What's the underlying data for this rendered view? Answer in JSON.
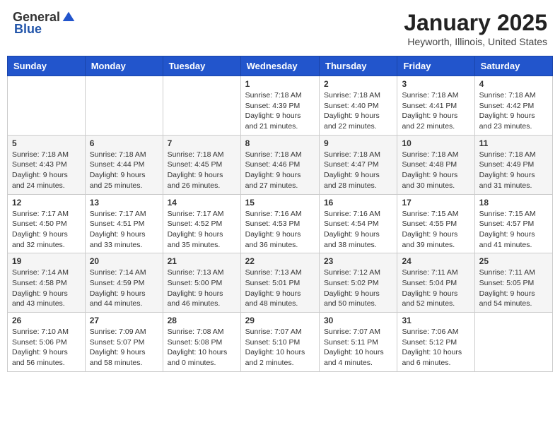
{
  "logo": {
    "general": "General",
    "blue": "Blue"
  },
  "header": {
    "month": "January 2025",
    "location": "Heyworth, Illinois, United States"
  },
  "days": [
    "Sunday",
    "Monday",
    "Tuesday",
    "Wednesday",
    "Thursday",
    "Friday",
    "Saturday"
  ],
  "weeks": [
    [
      {
        "date": "",
        "info": ""
      },
      {
        "date": "",
        "info": ""
      },
      {
        "date": "",
        "info": ""
      },
      {
        "date": "1",
        "info": "Sunrise: 7:18 AM\nSunset: 4:39 PM\nDaylight: 9 hours\nand 21 minutes."
      },
      {
        "date": "2",
        "info": "Sunrise: 7:18 AM\nSunset: 4:40 PM\nDaylight: 9 hours\nand 22 minutes."
      },
      {
        "date": "3",
        "info": "Sunrise: 7:18 AM\nSunset: 4:41 PM\nDaylight: 9 hours\nand 22 minutes."
      },
      {
        "date": "4",
        "info": "Sunrise: 7:18 AM\nSunset: 4:42 PM\nDaylight: 9 hours\nand 23 minutes."
      }
    ],
    [
      {
        "date": "5",
        "info": "Sunrise: 7:18 AM\nSunset: 4:43 PM\nDaylight: 9 hours\nand 24 minutes."
      },
      {
        "date": "6",
        "info": "Sunrise: 7:18 AM\nSunset: 4:44 PM\nDaylight: 9 hours\nand 25 minutes."
      },
      {
        "date": "7",
        "info": "Sunrise: 7:18 AM\nSunset: 4:45 PM\nDaylight: 9 hours\nand 26 minutes."
      },
      {
        "date": "8",
        "info": "Sunrise: 7:18 AM\nSunset: 4:46 PM\nDaylight: 9 hours\nand 27 minutes."
      },
      {
        "date": "9",
        "info": "Sunrise: 7:18 AM\nSunset: 4:47 PM\nDaylight: 9 hours\nand 28 minutes."
      },
      {
        "date": "10",
        "info": "Sunrise: 7:18 AM\nSunset: 4:48 PM\nDaylight: 9 hours\nand 30 minutes."
      },
      {
        "date": "11",
        "info": "Sunrise: 7:18 AM\nSunset: 4:49 PM\nDaylight: 9 hours\nand 31 minutes."
      }
    ],
    [
      {
        "date": "12",
        "info": "Sunrise: 7:17 AM\nSunset: 4:50 PM\nDaylight: 9 hours\nand 32 minutes."
      },
      {
        "date": "13",
        "info": "Sunrise: 7:17 AM\nSunset: 4:51 PM\nDaylight: 9 hours\nand 33 minutes."
      },
      {
        "date": "14",
        "info": "Sunrise: 7:17 AM\nSunset: 4:52 PM\nDaylight: 9 hours\nand 35 minutes."
      },
      {
        "date": "15",
        "info": "Sunrise: 7:16 AM\nSunset: 4:53 PM\nDaylight: 9 hours\nand 36 minutes."
      },
      {
        "date": "16",
        "info": "Sunrise: 7:16 AM\nSunset: 4:54 PM\nDaylight: 9 hours\nand 38 minutes."
      },
      {
        "date": "17",
        "info": "Sunrise: 7:15 AM\nSunset: 4:55 PM\nDaylight: 9 hours\nand 39 minutes."
      },
      {
        "date": "18",
        "info": "Sunrise: 7:15 AM\nSunset: 4:57 PM\nDaylight: 9 hours\nand 41 minutes."
      }
    ],
    [
      {
        "date": "19",
        "info": "Sunrise: 7:14 AM\nSunset: 4:58 PM\nDaylight: 9 hours\nand 43 minutes."
      },
      {
        "date": "20",
        "info": "Sunrise: 7:14 AM\nSunset: 4:59 PM\nDaylight: 9 hours\nand 44 minutes."
      },
      {
        "date": "21",
        "info": "Sunrise: 7:13 AM\nSunset: 5:00 PM\nDaylight: 9 hours\nand 46 minutes."
      },
      {
        "date": "22",
        "info": "Sunrise: 7:13 AM\nSunset: 5:01 PM\nDaylight: 9 hours\nand 48 minutes."
      },
      {
        "date": "23",
        "info": "Sunrise: 7:12 AM\nSunset: 5:02 PM\nDaylight: 9 hours\nand 50 minutes."
      },
      {
        "date": "24",
        "info": "Sunrise: 7:11 AM\nSunset: 5:04 PM\nDaylight: 9 hours\nand 52 minutes."
      },
      {
        "date": "25",
        "info": "Sunrise: 7:11 AM\nSunset: 5:05 PM\nDaylight: 9 hours\nand 54 minutes."
      }
    ],
    [
      {
        "date": "26",
        "info": "Sunrise: 7:10 AM\nSunset: 5:06 PM\nDaylight: 9 hours\nand 56 minutes."
      },
      {
        "date": "27",
        "info": "Sunrise: 7:09 AM\nSunset: 5:07 PM\nDaylight: 9 hours\nand 58 minutes."
      },
      {
        "date": "28",
        "info": "Sunrise: 7:08 AM\nSunset: 5:08 PM\nDaylight: 10 hours\nand 0 minutes."
      },
      {
        "date": "29",
        "info": "Sunrise: 7:07 AM\nSunset: 5:10 PM\nDaylight: 10 hours\nand 2 minutes."
      },
      {
        "date": "30",
        "info": "Sunrise: 7:07 AM\nSunset: 5:11 PM\nDaylight: 10 hours\nand 4 minutes."
      },
      {
        "date": "31",
        "info": "Sunrise: 7:06 AM\nSunset: 5:12 PM\nDaylight: 10 hours\nand 6 minutes."
      },
      {
        "date": "",
        "info": ""
      }
    ]
  ]
}
